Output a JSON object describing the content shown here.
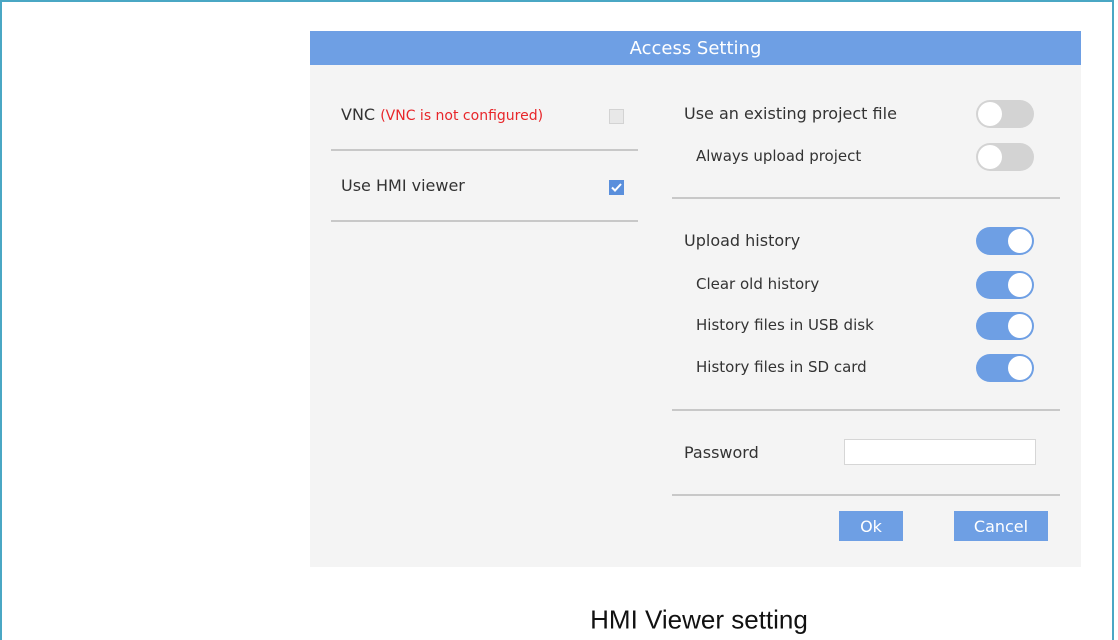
{
  "dialog": {
    "title": "Access Setting",
    "vnc": {
      "label": "VNC",
      "warning": "(VNC is not configured)",
      "checked": false,
      "enabled": false
    },
    "hmi_viewer": {
      "label": "Use HMI viewer",
      "checked": true
    },
    "project": {
      "use_existing_label": "Use an existing project file",
      "use_existing_on": false,
      "always_upload_label": "Always upload project",
      "always_upload_on": false
    },
    "history": {
      "upload_label": "Upload history",
      "upload_on": true,
      "clear_old_label": "Clear old history",
      "clear_old_on": true,
      "usb_label": "History files in USB disk",
      "usb_on": true,
      "sd_label": "History files in SD card",
      "sd_on": true
    },
    "password": {
      "label": "Password",
      "value": ""
    },
    "buttons": {
      "ok": "Ok",
      "cancel": "Cancel"
    }
  },
  "caption": "HMI Viewer setting",
  "colors": {
    "accent": "#6e9fe4",
    "warning": "#e8262a",
    "dialog_bg": "#f4f4f4",
    "frame": "#4aa7c4"
  }
}
